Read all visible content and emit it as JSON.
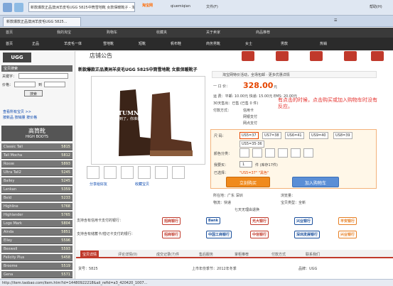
{
  "browser": {
    "tab_title": "新款爆款正品澳洲羊皮毛UGG 5825中筒雪地靴 女款保暖靴子 - 淘宝",
    "menu_help": "帮助(H)",
    "menu_items": [
      "文件(F)",
      "帮助(H)"
    ],
    "address_tabs": [
      "新款爆款正品澳洲羊皮毛UGG 5825...",
      "淘宝网",
      "qiuemiqian",
      "文件(F)"
    ]
  },
  "top_nav": [
    "首页",
    "我的淘宝",
    "购物车",
    "收藏夹",
    "关于卖家",
    "商品推荐"
  ],
  "sub_nav": [
    "首页",
    "正品",
    "羊皮毛一体",
    "雪地靴",
    "短靴",
    "帆布鞋",
    "商务男靴",
    "女士",
    "男款",
    "热销"
  ],
  "sidebar": {
    "search_title": "宝贝搜索",
    "keyword_label": "关键字：",
    "price_label": "价格：",
    "to_label": "到",
    "search_btn": "搜索",
    "links": [
      "查看所有宝贝 >>",
      "按新品  按销量  按价格"
    ],
    "category_title": "高筒靴",
    "category_sub": "HIGH BOOTS",
    "items": [
      {
        "name": "Classic Tall",
        "count": "5815"
      },
      {
        "name": "Tall Mocha",
        "count": "5812"
      },
      {
        "name": "Roxxe",
        "count": "5893"
      },
      {
        "name": "Ultra Tall2",
        "count": "5245"
      },
      {
        "name": "Bailey",
        "count": "5245"
      },
      {
        "name": "Lenkan",
        "count": "5359"
      },
      {
        "name": "Beld",
        "count": "5233"
      },
      {
        "name": "Highline",
        "count": "5768"
      },
      {
        "name": "Highlander",
        "count": "5765"
      },
      {
        "name": "Logo Mark",
        "count": "5804"
      },
      {
        "name": "Ainda",
        "count": "5851"
      },
      {
        "name": "Elley",
        "count": "5596"
      },
      {
        "name": "Bexwell",
        "count": "5593"
      },
      {
        "name": "Felicity Plus",
        "count": "5458"
      },
      {
        "name": "Broome",
        "count": "5519"
      },
      {
        "name": "Gena",
        "count": "5571"
      }
    ]
  },
  "store": {
    "logo": "UGG",
    "title": "店铺公告",
    "icons": [
      "热卖",
      "新品",
      "特价",
      "收藏",
      "帮助"
    ]
  },
  "product": {
    "title": "新款爆款正品澳洲羊皮毛UGG 5825中筒雪地靴 女款保暖靴子",
    "img_caption": "AUTUMN",
    "img_sub": "秋天快到了，你准备好了吗",
    "notice": "淘宝网特价活动，全场包邮 · 更多优惠详情",
    "price_label": "一 口 价：",
    "price": "328.00",
    "price_unit": "元",
    "shipping": "运  费：平邮: 10.00元 快递: 15.00元 EMS: 20.00元",
    "sold": "30天售出：已售 (已售 0 件)",
    "payment_label": "付款方式：",
    "payment_items": [
      "信用卡",
      "快捷支付",
      "余额宝支付"
    ],
    "payment_items2": [
      "网银支付",
      "找人代付",
      "货到付款"
    ],
    "payment_items3": [
      "网点支付",
      "支付宝余额"
    ],
    "size_label": "尺  码：",
    "sizes": [
      "US5=37",
      "US7=38",
      "US6=41",
      "US9=40",
      "US8=39",
      "US5=35-36"
    ],
    "color_label": "颜色分类：",
    "qty_label": "我要买：",
    "qty_value": "1",
    "stock": "件 (库存17件)",
    "selected_label": "已选择：",
    "selected_value": "\"US5=37\" \"黑色\"",
    "buy_label": "立刻购买",
    "cart_label": "加入购物车",
    "annotation": "有点击的时候，点击购买或加入购物车时没有反应。",
    "meta": [
      "所在地：广东 深圳",
      "浏览量：",
      "物流：快递",
      "宝贝类型：全新",
      "七天无理由退换"
    ],
    "share": [
      "分享给好友",
      "收藏宝贝"
    ],
    "credit_label": "支持含有信用卡支付的银行：",
    "debit_label": "支持含有储蓄卡/借记卡支付的银行：",
    "banks1": [
      "招商银行",
      "Bank",
      "光大银行",
      "兴业银行",
      "平安银行"
    ],
    "banks2": [
      "招商银行",
      "中国工商银行",
      "中信银行",
      "深圳发展银行",
      "兴业银行"
    ]
  },
  "bottom_tabs": [
    "宝贝详情",
    "评论详情(0)",
    "成交记录(7)件",
    "售后服务",
    "掌柜推荐",
    "付款方式",
    "联系我们"
  ],
  "bottom_info": [
    "货号：5825",
    "上市年份季节：2012年冬季",
    "品牌：UGG"
  ],
  "status": "http://item.taobao.com/item.htm?id=14480922218&ali_refid=a3_420420_1007..."
}
